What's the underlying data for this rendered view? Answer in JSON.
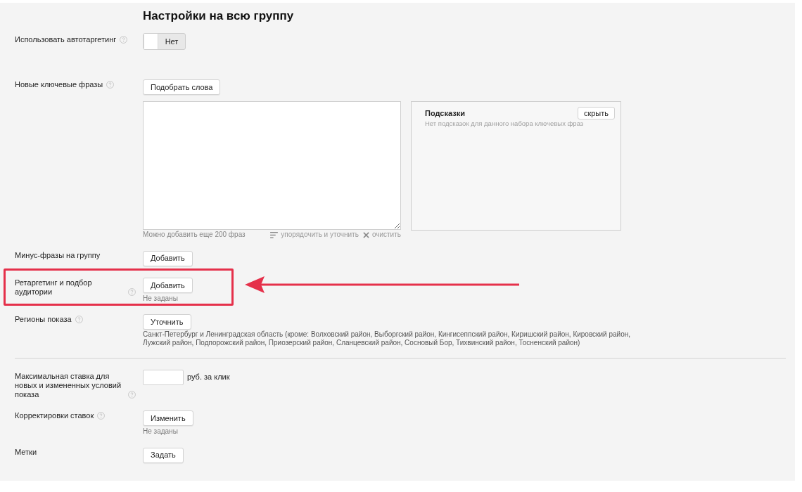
{
  "title": "Настройки на всю группу",
  "sections": [
    {
      "rows": [
        {
          "kind": "toggle",
          "label": "Использовать автотаргетинг",
          "help": true,
          "toggle": {
            "label": "Нет",
            "on": false
          }
        },
        {
          "kind": "keywords",
          "label": "Новые ключевые фразы",
          "help": true,
          "button": "Подобрать слова",
          "textarea": {
            "note": "Можно добавить еще 200 фраз",
            "actions": [
              {
                "kind": "sort",
                "label": "упорядочить и уточнить",
                "disabled": true
              },
              {
                "kind": "clear",
                "label": "очистить",
                "disabled": true
              }
            ]
          },
          "hints": {
            "title": "Подсказки",
            "button": "скрыть",
            "text": "Нет подсказок для данного набора ключевых фраз"
          }
        },
        {
          "kind": "button",
          "label": "Минус-фразы на группу",
          "help": false,
          "button": "Добавить"
        },
        {
          "kind": "button",
          "label": "Ретаргетинг и подбор аудитории",
          "help": true,
          "button": "Добавить",
          "note": "Не заданы",
          "highlighted": true
        },
        {
          "kind": "button",
          "label": "Регионы показа",
          "help": true,
          "button": "Уточнить",
          "details": "Санкт-Петербург и Ленинградская область (кроме: Волховский район, Выборгский район, Кингисеппский район, Киришский район, Кировский район, Лужский район, Подпорожский район, Приозерский район, Сланцевский район, Сосновый Бор, Тихвинский район, Тосненский район)"
        }
      ]
    },
    {
      "rows": [
        {
          "kind": "input",
          "label": "Максимальная ставка для новых и измененных условий показа",
          "help": true,
          "unit": "руб. за клик"
        },
        {
          "kind": "button",
          "label": "Корректировки ставок",
          "help": true,
          "button": "Изменить",
          "note": "Не заданы"
        },
        {
          "kind": "button",
          "label": "Метки",
          "help": false,
          "button": "Задать"
        }
      ]
    }
  ]
}
